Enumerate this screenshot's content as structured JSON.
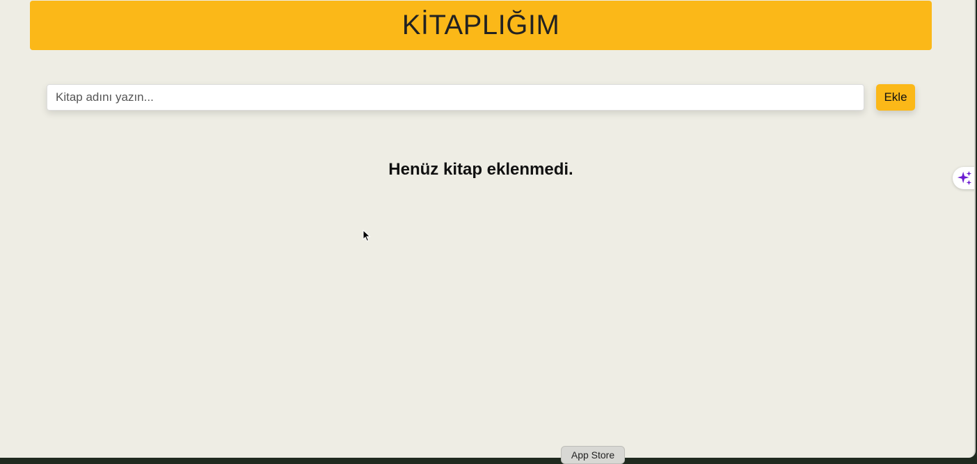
{
  "header": {
    "title": "KİTAPLIĞIM"
  },
  "form": {
    "input_placeholder": "Kitap adını yazın...",
    "input_value": "",
    "add_label": "Ekle"
  },
  "list": {
    "empty_message": "Henüz kitap eklenmedi."
  },
  "dock": {
    "tooltip": "App Store"
  },
  "colors": {
    "accent": "#fbb818",
    "background": "#eeede4",
    "ai_icon": "#6a1bd1"
  },
  "icons": {
    "assistant": "sparkle-icon",
    "pointer": "mouse-cursor-icon"
  }
}
